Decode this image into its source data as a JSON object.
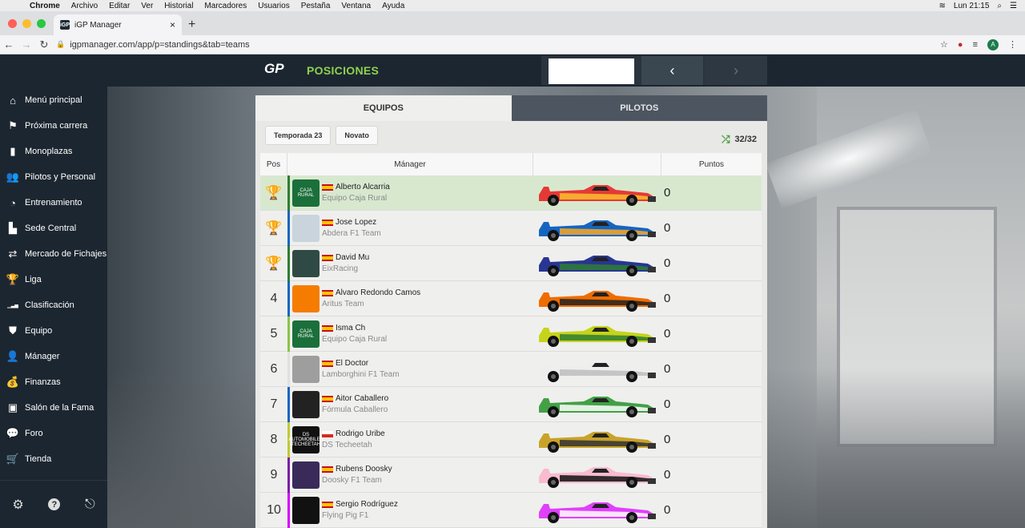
{
  "os_menu": {
    "app": "Chrome",
    "items": [
      "Archivo",
      "Editar",
      "Ver",
      "Historial",
      "Marcadores",
      "Usuarios",
      "Pestaña",
      "Ventana",
      "Ayuda"
    ],
    "clock": "Lun 21:15"
  },
  "browser": {
    "tab_title": "iGP Manager",
    "url": "igpmanager.com/app/p=standings&tab=teams",
    "avatar_letter": "A",
    "favicon_text": "iGP"
  },
  "sidebar": {
    "items": [
      {
        "label": "Menú principal",
        "icon": "home-icon",
        "glyph": "⌂"
      },
      {
        "label": "Próxima carrera",
        "icon": "flag-icon",
        "glyph": "⚑"
      },
      {
        "label": "Monoplazas",
        "icon": "car-icon",
        "glyph": "▮"
      },
      {
        "label": "Pilotos y Personal",
        "icon": "people-icon",
        "glyph": "👥"
      },
      {
        "label": "Entrenamiento",
        "icon": "stopwatch-icon",
        "glyph": "◔"
      },
      {
        "label": "Sede Central",
        "icon": "factory-icon",
        "glyph": "▙"
      },
      {
        "label": "Mercado de Fichajes",
        "icon": "transfer-icon",
        "glyph": "⇄"
      },
      {
        "label": "Liga",
        "icon": "trophy-icon",
        "glyph": "🏆"
      },
      {
        "label": "Clasificación",
        "icon": "chart-icon",
        "glyph": "▁▃▅"
      },
      {
        "label": "Equipo",
        "icon": "shield-icon",
        "glyph": "⛊"
      },
      {
        "label": "Mánager",
        "icon": "user-icon",
        "glyph": "👤"
      },
      {
        "label": "Finanzas",
        "icon": "money-bag-icon",
        "glyph": "💰"
      },
      {
        "label": "Salón de la Fama",
        "icon": "hall-icon",
        "glyph": "▣"
      },
      {
        "label": "Foro",
        "icon": "chat-icon",
        "glyph": "💬"
      },
      {
        "label": "Tienda",
        "icon": "cart-icon",
        "glyph": "🛒"
      }
    ],
    "bottom_icons": [
      "gear-icon",
      "help-icon",
      "logout-icon"
    ]
  },
  "header": {
    "title": "POSICIONES",
    "logo_text": "GP"
  },
  "tabs": {
    "teams": "EQUIPOS",
    "drivers": "PILOTOS"
  },
  "filters": {
    "season": "Temporada 23",
    "tier": "Novato"
  },
  "counter": "32/32",
  "table": {
    "headers": {
      "pos": "Pos",
      "manager": "Mánager",
      "car": "",
      "points": "Puntos"
    },
    "rows": [
      {
        "pos": "",
        "trophy": "gold",
        "manager": "Alberto Alcarria",
        "team": "Equipo Caja Rural",
        "points": "0",
        "bar": "#2e7d32",
        "badge": "#1b6f3a",
        "badge_text": "CAJA RURAL",
        "car": [
          "#e53935",
          "#fbc02d"
        ]
      },
      {
        "pos": "",
        "trophy": "silver",
        "manager": "Jose Lopez",
        "team": "Abdera F1 Team",
        "points": "0",
        "bar": "#1565c0",
        "badge": "#c9d4dd",
        "badge_text": "",
        "car": [
          "#1565c0",
          "#f9a825"
        ]
      },
      {
        "pos": "",
        "trophy": "bronze",
        "manager": "David Mu",
        "team": "EixRacing",
        "points": "0",
        "bar": "#2e7d32",
        "badge": "#2f4a44",
        "badge_text": "",
        "car": [
          "#283593",
          "#2e7d32"
        ]
      },
      {
        "pos": "4",
        "trophy": "",
        "manager": "Alvaro Redondo Camos",
        "team": "Aritus Team",
        "points": "0",
        "bar": "#1565c0",
        "badge": "#f57c00",
        "badge_text": "",
        "car": [
          "#ef6c00",
          "#222222"
        ]
      },
      {
        "pos": "5",
        "trophy": "",
        "manager": "Isma Ch",
        "team": "Equipo Caja Rural",
        "points": "0",
        "bar": "#8bc34a",
        "badge": "#1b6f3a",
        "badge_text": "CAJA RURAL",
        "car": [
          "#c6d419",
          "#2e7d32"
        ]
      },
      {
        "pos": "6",
        "trophy": "",
        "manager": "El Doctor",
        "team": "Lamborghini F1 Team",
        "points": "0",
        "bar": "#e0e0e0",
        "badge": "#9e9e9e",
        "badge_text": "",
        "car": [
          "#eeeeee",
          "#bdbdbd"
        ]
      },
      {
        "pos": "7",
        "trophy": "",
        "manager": "Aitor Caballero",
        "team": "Fórmula Caballero",
        "points": "0",
        "bar": "#1565c0",
        "badge": "#222222",
        "badge_text": "",
        "car": [
          "#43a047",
          "#ffffff"
        ]
      },
      {
        "pos": "8",
        "trophy": "",
        "manager": "Rodrigo Uribe",
        "team": "DS Techeetah",
        "points": "0",
        "bar": "#c0ca33",
        "badge": "#111111",
        "badge_text": "DS AUTOMOBILES TECHEETAH",
        "car": [
          "#c8a32a",
          "#333333"
        ]
      },
      {
        "pos": "9",
        "trophy": "",
        "manager": "Rubens Doosky",
        "team": "Doosky F1 Team",
        "points": "0",
        "bar": "#7b1fa2",
        "badge": "#3a2a5a",
        "badge_text": "",
        "car": [
          "#f8bbd0",
          "#111111"
        ]
      },
      {
        "pos": "10",
        "trophy": "",
        "manager": "Sergio Rodríguez",
        "team": "Flying Pig F1",
        "points": "0",
        "bar": "#d500f9",
        "badge": "#111111",
        "badge_text": "",
        "car": [
          "#e040fb",
          "#ffffff"
        ]
      }
    ]
  },
  "colors": {
    "accent": "#8fd14f",
    "sidebar": "#1c2630",
    "gold": "#c9a227",
    "silver": "#9e9e9e",
    "bronze": "#b07a3b"
  }
}
